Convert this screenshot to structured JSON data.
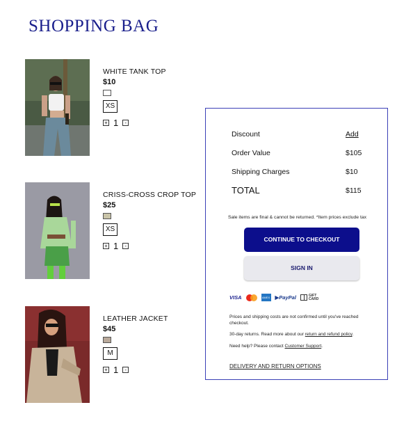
{
  "page": {
    "title": "SHOPPING BAG"
  },
  "items": [
    {
      "name": "WHITE TANK TOP",
      "price": "$10",
      "size": "XS",
      "quantity": "1",
      "swatch_color": "#ffffff"
    },
    {
      "name": "CRISS-CROSS CROP TOP",
      "price": "$25",
      "size": "XS",
      "quantity": "1",
      "swatch_color": "#c9c4a8"
    },
    {
      "name": "LEATHER JACKET",
      "price": "$45",
      "size": "M",
      "quantity": "1",
      "swatch_color": "#b9a99a"
    }
  ],
  "qty_controls": {
    "plus": "+",
    "minus": "-"
  },
  "summary": {
    "discount_label": "Discount",
    "discount_action": "Add",
    "order_value_label": "Order Value",
    "order_value": "$105",
    "shipping_label": "Shipping Charges",
    "shipping_value": "$10",
    "total_label": "TOTAL",
    "total_value": "$115",
    "note": "Sale items are final & cannot be returned. *Item prices exclude tax",
    "checkout_button": "CONTINUE TO CHECKOUT",
    "signin_button": "SIGN IN",
    "payments": {
      "visa": "VISA",
      "amex": "AMEX",
      "paypal": "PayPal",
      "gift_line1": "GIFT",
      "gift_line2": "CARD"
    },
    "info1": "Prices and shipping costs are not confirmed until you've reached checkout.",
    "info2_prefix": "30-day returns. Read more about our ",
    "info2_link": "return and refund policy",
    "info2_suffix": ".",
    "info3_prefix": "Need help? Please contact ",
    "info3_link": "Customer Support",
    "info3_suffix": ".",
    "delivery_link": "DELIVERY AND RETURN OPTIONS"
  },
  "colors": {
    "accent": "#0c0e8c",
    "title": "#1a1f8c",
    "panel_border": "#3a3fb6"
  }
}
